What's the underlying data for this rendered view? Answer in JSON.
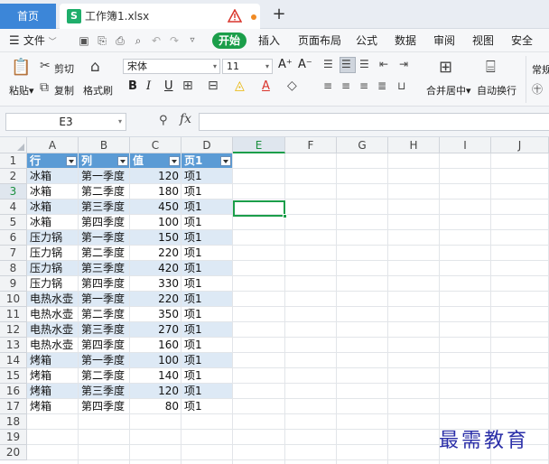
{
  "tabs": {
    "home": "首页",
    "document": "工作簿1.xlsx",
    "doc_icon_letter": "S",
    "add": "+"
  },
  "menu": {
    "file": "文件",
    "start": "开始",
    "items": [
      "插入",
      "页面布局",
      "公式",
      "数据",
      "审阅",
      "视图",
      "安全"
    ]
  },
  "ribbon": {
    "paste": "粘贴",
    "cut": "剪切",
    "copy": "复制",
    "format_painter": "格式刷",
    "font_name": "宋体",
    "font_size": "11",
    "font_grow": "A⁺",
    "font_shrink": "A⁻",
    "bold": "B",
    "italic": "I",
    "underline": "U",
    "merge_center": "合并居中",
    "wrap_text": "自动换行",
    "normal": "常规"
  },
  "formula_bar": {
    "name_box": "E3",
    "fx": "fx",
    "formula": ""
  },
  "sheet": {
    "columns": [
      "A",
      "B",
      "C",
      "D",
      "E",
      "F",
      "G",
      "H",
      "I",
      "J"
    ],
    "active_column": "E",
    "active_row": 3,
    "rows": [
      "1",
      "2",
      "3",
      "4",
      "5",
      "6",
      "7",
      "8",
      "9",
      "10",
      "11",
      "12",
      "13",
      "14",
      "15",
      "16",
      "17",
      "18",
      "19",
      "20"
    ],
    "header": [
      "行",
      "列",
      "值",
      "页1"
    ],
    "data": [
      [
        "冰箱",
        "第一季度",
        "120",
        "项1"
      ],
      [
        "冰箱",
        "第二季度",
        "180",
        "项1"
      ],
      [
        "冰箱",
        "第三季度",
        "450",
        "项1"
      ],
      [
        "冰箱",
        "第四季度",
        "100",
        "项1"
      ],
      [
        "压力锅",
        "第一季度",
        "150",
        "项1"
      ],
      [
        "压力锅",
        "第二季度",
        "220",
        "项1"
      ],
      [
        "压力锅",
        "第三季度",
        "420",
        "项1"
      ],
      [
        "压力锅",
        "第四季度",
        "330",
        "项1"
      ],
      [
        "电热水壶",
        "第一季度",
        "220",
        "项1"
      ],
      [
        "电热水壶",
        "第二季度",
        "350",
        "项1"
      ],
      [
        "电热水壶",
        "第三季度",
        "270",
        "项1"
      ],
      [
        "电热水壶",
        "第四季度",
        "160",
        "项1"
      ],
      [
        "烤箱",
        "第一季度",
        "100",
        "项1"
      ],
      [
        "烤箱",
        "第二季度",
        "140",
        "项1"
      ],
      [
        "烤箱",
        "第三季度",
        "120",
        "项1"
      ],
      [
        "烤箱",
        "第四季度",
        "80",
        "项1"
      ]
    ]
  },
  "colors": {
    "accent_green": "#1b9e4a",
    "table_header": "#5b9bd5",
    "table_band": "#dde9f5",
    "home_tab": "#3c86d8"
  },
  "watermark": "最需教育"
}
